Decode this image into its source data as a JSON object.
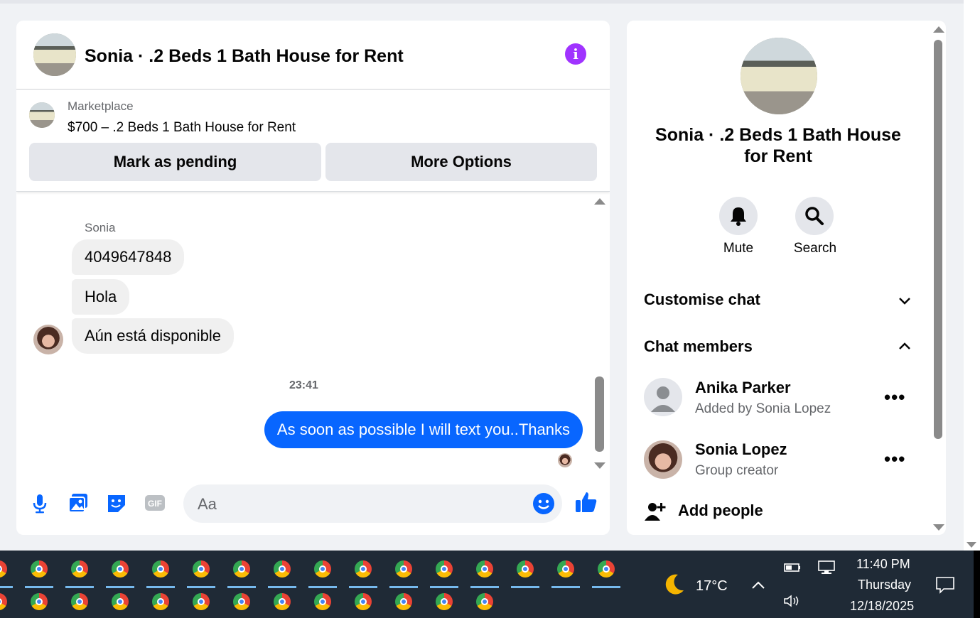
{
  "chat": {
    "title": "Sonia · .2 Beds 1 Bath House for Rent",
    "listing": {
      "label": "Marketplace",
      "price_title": "$700 – .2 Beds 1 Bath House for Rent",
      "mark_pending": "Mark as pending",
      "more_options": "More Options"
    },
    "messages": {
      "sender": "Sonia",
      "incoming": [
        "4049647848",
        "Hola",
        "Aún está disponible"
      ],
      "timestamp": "23:41",
      "outgoing": "As soon as possible I will text you..Thanks"
    },
    "composer": {
      "placeholder": "Aa"
    }
  },
  "side": {
    "title": "Sonia · .2 Beds 1 Bath House for Rent",
    "mute_label": "Mute",
    "search_label": "Search",
    "customise_chat": "Customise chat",
    "chat_members": "Chat members",
    "members": [
      {
        "name": "Anika Parker",
        "sub": "Added by Sonia Lopez"
      },
      {
        "name": "Sonia Lopez",
        "sub": "Group creator"
      }
    ],
    "add_people": "Add people"
  },
  "taskbar": {
    "weather": "17°C",
    "time": "11:40 PM",
    "day": "Thursday",
    "date": "12/18/2025"
  },
  "colors": {
    "accent": "#0866ff",
    "info": "#a033ff",
    "taskbar": "#1f2a36"
  }
}
